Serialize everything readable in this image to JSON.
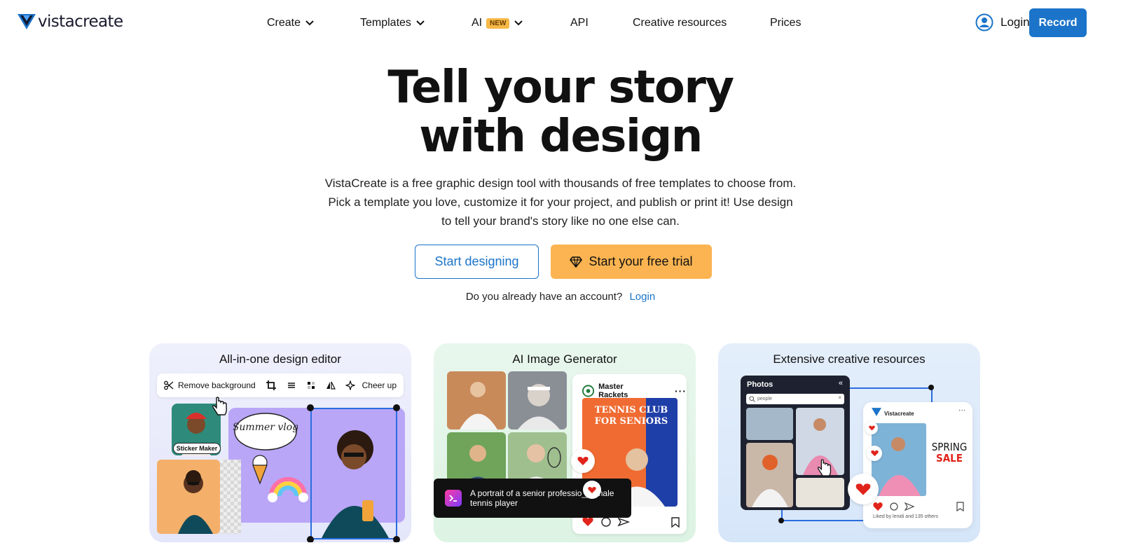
{
  "brand": {
    "name": "vistacreate",
    "trademark": "."
  },
  "nav": {
    "items": [
      {
        "label": "Create",
        "dropdown": true
      },
      {
        "label": "Templates",
        "dropdown": true
      },
      {
        "label": "AI",
        "badge": "NEW",
        "dropdown": true
      },
      {
        "label": "API",
        "dropdown": false
      },
      {
        "label": "Creative resources",
        "dropdown": false
      },
      {
        "label": "Prices",
        "dropdown": false
      }
    ],
    "login_label": "Login",
    "record_label": "Record"
  },
  "hero": {
    "title_line1": "Tell your story",
    "title_line2": "with design",
    "desc_line1": "VistaCreate is a free graphic design tool with thousands of free templates to choose from.",
    "desc_line2": "Pick a template you love, customize it for your project, and publish or print it! Use design",
    "desc_line3": "to tell your brand's story like no one else can.",
    "primary_cta": "Start designing",
    "secondary_cta": "Start your free trial",
    "account_question": "Do you already have an account?",
    "account_login": "Login"
  },
  "cards": [
    {
      "title": "All-in-one design editor",
      "toolbar_remove_bg": "Remove background",
      "toolbar_cheer": "Cheer up",
      "sticker_label": "Sticker Maker",
      "summer_text": "Summer vlog"
    },
    {
      "title": "AI Image Generator",
      "account_name": "Master Rackets",
      "poster_title": "TENNIS CLUB FOR SENIORS",
      "prompt_text": "A portrait of a senior professio___male tennis player"
    },
    {
      "title": "Extensive creative resources",
      "panel_title": "Photos",
      "search_value": "people",
      "post_brand": "Vistacreate",
      "spring": "SPRING",
      "sale": "SALE",
      "liked_text": "Liked by lenidi and 135 others"
    }
  ],
  "colors": {
    "primary_blue": "#1b74c9",
    "cta_orange": "#fbb451",
    "badge_orange": "#f6b947",
    "card1_bg": "#e8eafb",
    "card2_bg": "#e2f5e7",
    "card3_bg": "#dde9fa"
  },
  "icons": {
    "logo": "vistacreate-logo-icon",
    "chevron": "chevron-down-icon",
    "user": "user-circle-icon",
    "diamond": "diamond-icon",
    "scissors": "scissors-icon",
    "heart": "heart-icon"
  }
}
